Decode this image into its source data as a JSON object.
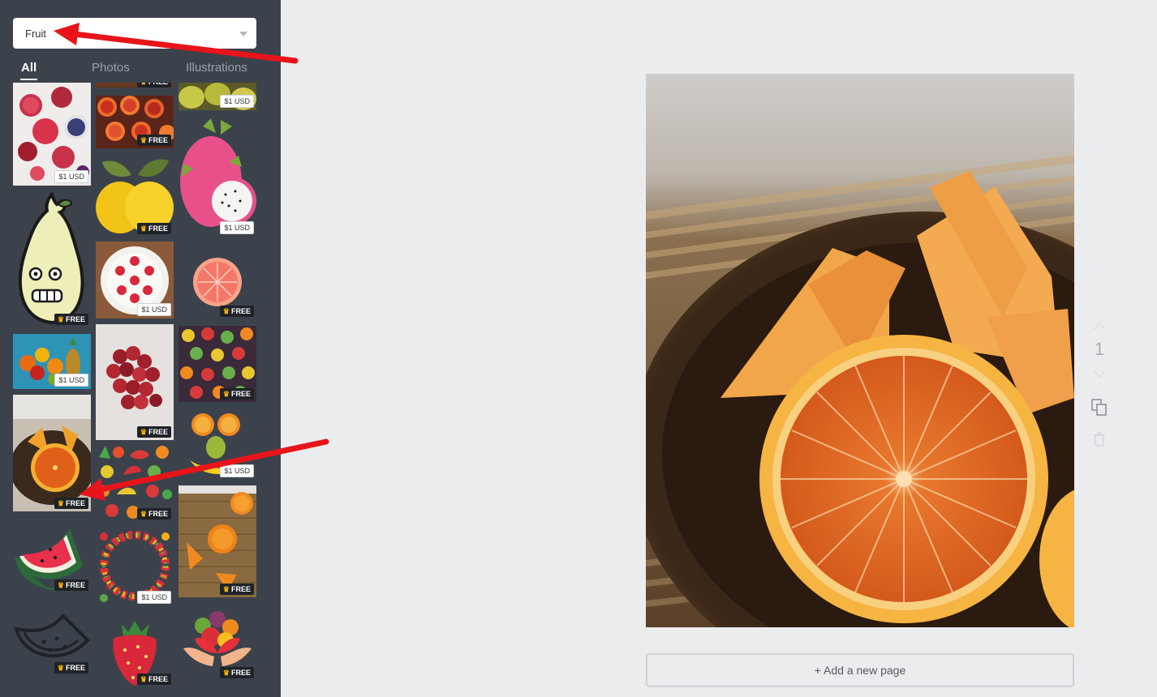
{
  "search": {
    "value": "Fruit"
  },
  "tabs": [
    {
      "label": "All"
    },
    {
      "label": "Photos"
    },
    {
      "label": "Illustrations"
    }
  ],
  "badges": {
    "free": "FREE",
    "paid": "$1 USD"
  },
  "editor": {
    "page_number": "1",
    "add_page_label": "+ Add a new page"
  },
  "colors": {
    "sidebar": "#3c424b",
    "canvas_bg": "#ebecee",
    "annotation_arrow": "#e8141b",
    "free_badge": "#1f2328",
    "crown": "#f5b301"
  }
}
